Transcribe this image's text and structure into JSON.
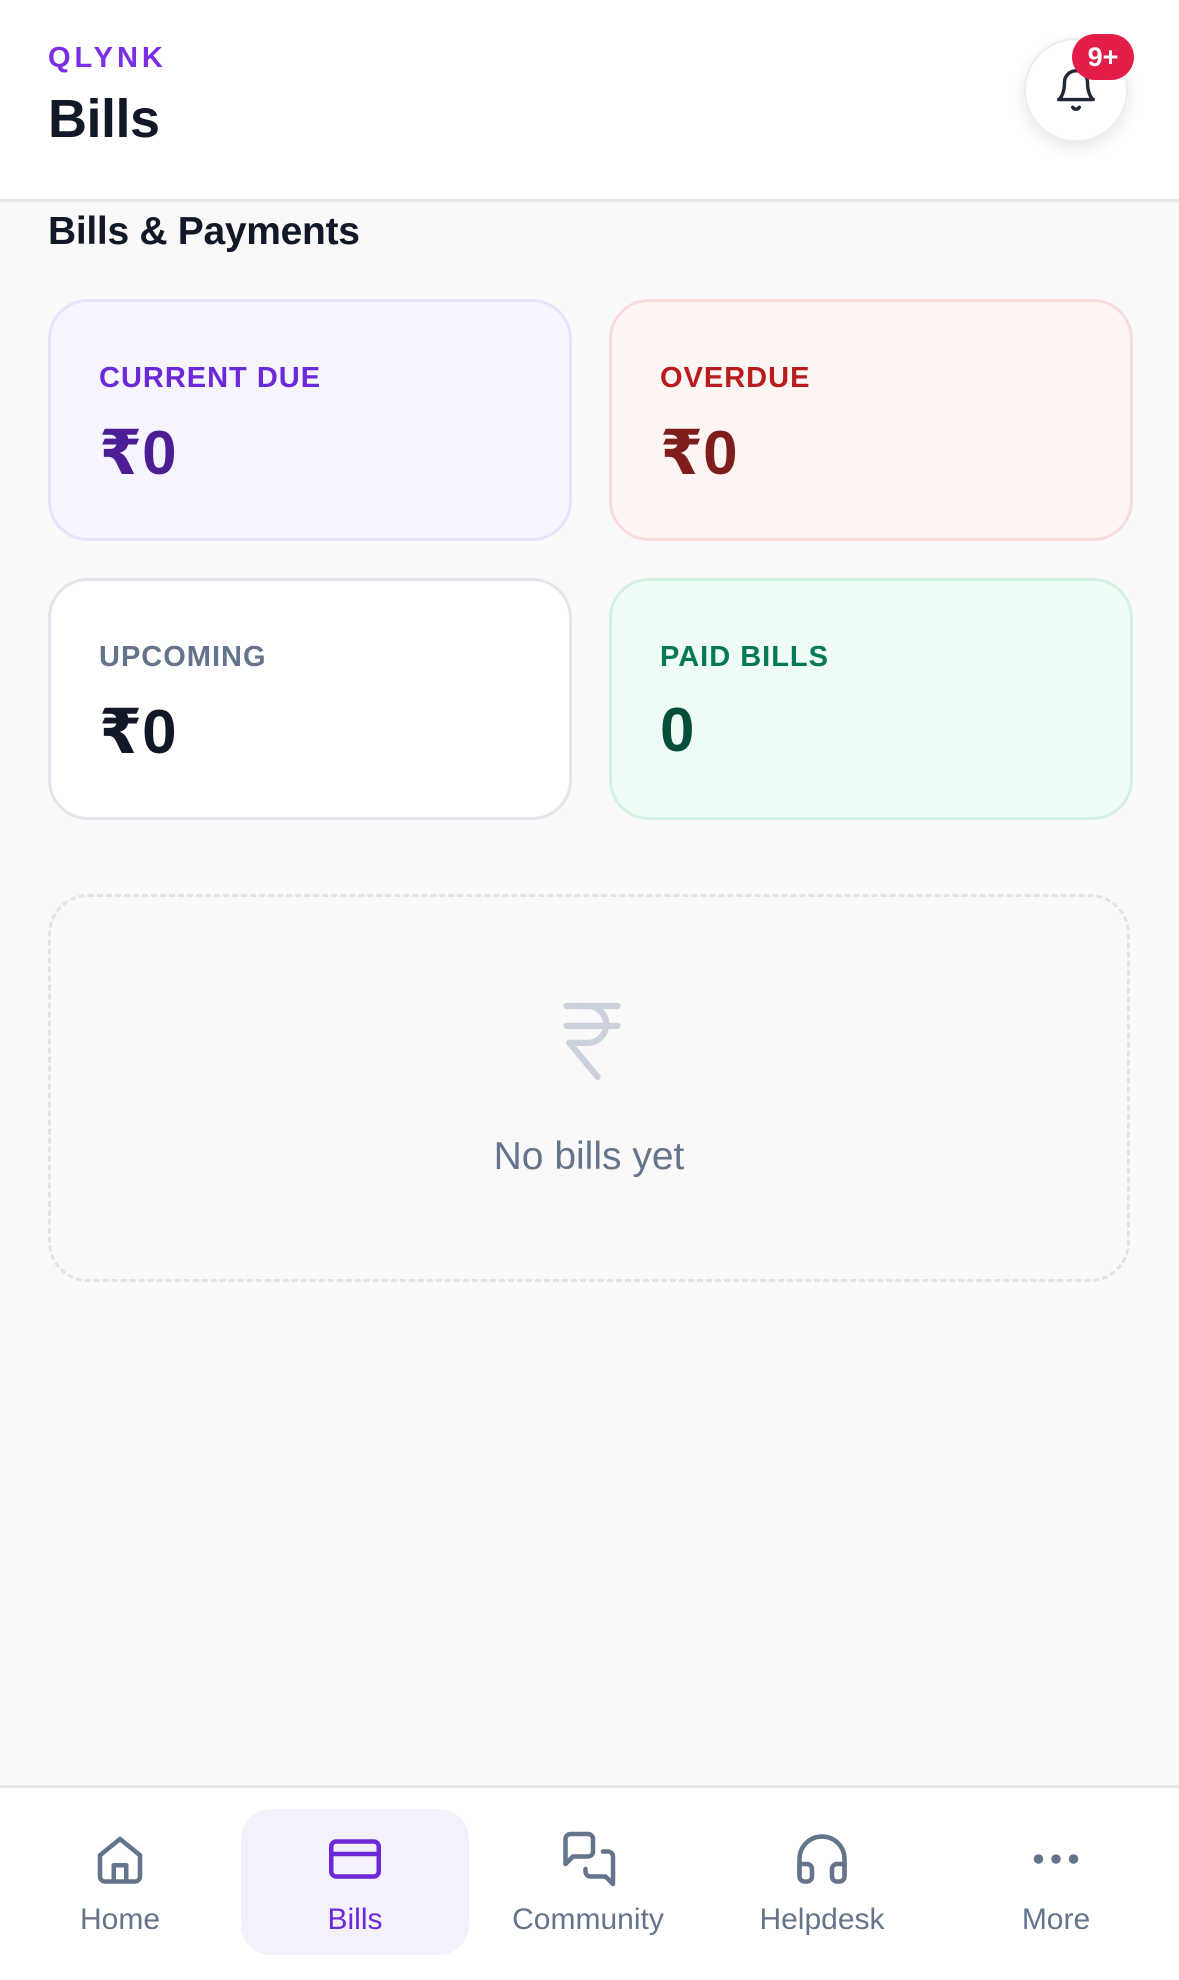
{
  "header": {
    "brand": "QLYNK",
    "title": "Bills",
    "notifications_badge": "9+"
  },
  "section": {
    "title": "Bills & Payments"
  },
  "stats": {
    "current_due": {
      "label": "CURRENT DUE",
      "value": "₹0"
    },
    "overdue": {
      "label": "OVERDUE",
      "value": "₹0"
    },
    "upcoming": {
      "label": "UPCOMING",
      "value": "₹0"
    },
    "paid_bills": {
      "label": "PAID BILLS",
      "value": "0"
    }
  },
  "empty_state": {
    "icon": "rupee-icon",
    "text": "No bills yet"
  },
  "bottom_nav": {
    "active": "Bills",
    "items": [
      {
        "label": "Home",
        "icon": "home-icon"
      },
      {
        "label": "Bills",
        "icon": "credit-card-icon"
      },
      {
        "label": "Community",
        "icon": "chat-bubbles-icon"
      },
      {
        "label": "Helpdesk",
        "icon": "headphones-icon"
      },
      {
        "label": "More",
        "icon": "more-dots-icon"
      }
    ]
  },
  "colors": {
    "brand": "#7c2ee6",
    "active_nav": "#6d28d9",
    "badge": "#e11d48"
  }
}
